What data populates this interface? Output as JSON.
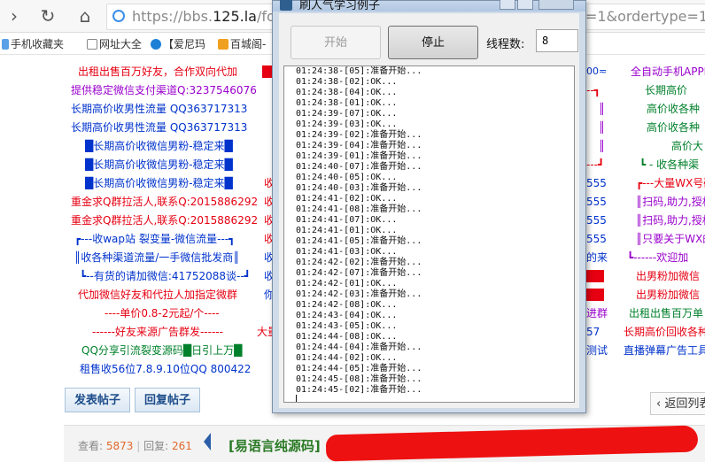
{
  "browser": {
    "url_gray_prefix": "https://bbs.",
    "url_host": "125.la",
    "url_path": "/foru",
    "url_tail": "=1&ordertype=1#",
    "bookmarks": [
      "手机收藏夹",
      "网址大全",
      "【爱尼玛",
      "百城阁-"
    ]
  },
  "ads": {
    "col1": [
      "出租出售百万好友，合作双向代加",
      "提供稳定微信支付渠道Q:3237546076",
      "长期高价收男性流量   QQ363717313",
      "长期高价收男性流量   QQ363717313",
      "█长期高价收微信男粉-稳定来█",
      "█长期高价收微信男粉-稳定来█",
      "█长期高价收微信男粉-稳定来█",
      "重金求Q群拉活人,联系Q:2015886292",
      "重金求Q群拉活人,联系Q:2015886292",
      "┏---收wap站  裂变量-微信流量---┓",
      "║收各种渠道流量/一手微信批发商║",
      "┗--有货的请加微信:41752088谈--┛",
      "代加微信好友和代拉人加指定微群",
      "----单价0.8-2元起/个----",
      "------好友来源广告群发------",
      "QQ分享引流裂变源码█日引上万█",
      "租售收56位7.8.9.10位QQ 800422"
    ],
    "col2": [
      "收",
      "收",
      "收",
      "收",
      "收",
      "收",
      "你",
      "大量"
    ],
    "col3": [
      "555",
      "555",
      "555",
      "555",
      "的来",
      "进群",
      "57",
      "测试"
    ],
    "col4": [
      "全自动手机APPE",
      "长期高价",
      "高价收各种",
      "高价收各种",
      "高价大",
      "┗ - 收各种渠",
      "┏---大量WX号码",
      "║扫码,助力,授权",
      "║扫码,助力,授权",
      "║只要关于WX的",
      "┗------欢迎加",
      "出男粉加微信",
      "出男粉加微信",
      "出租出售百万单",
      "长期高价回收各种",
      "直播弹幕广告工具"
    ]
  },
  "popup": {
    "title": "刷人气学习例子",
    "start_label": "开始",
    "stop_label": "停止",
    "threads_label": "线程数:",
    "threads_value": "8",
    "log": [
      "01:24:38-[05]:准备开始...",
      "01:24:38-[02]:OK...",
      "01:24:38-[04]:OK...",
      "01:24:38-[01]:OK...",
      "01:24:39-[07]:OK...",
      "01:24:39-[03]:OK...",
      "01:24:39-[02]:准备开始...",
      "01:24:39-[04]:准备开始...",
      "01:24:39-[01]:准备开始...",
      "01:24:40-[07]:准备开始...",
      "01:24:40-[05]:OK...",
      "01:24:40-[03]:准备开始...",
      "01:24:41-[02]:OK...",
      "01:24:41-[08]:准备开始...",
      "01:24:41-[07]:OK...",
      "01:24:41-[01]:OK...",
      "01:24:41-[05]:准备开始...",
      "01:24:41-[03]:OK...",
      "01:24:42-[02]:准备开始...",
      "01:24:42-[07]:准备开始...",
      "01:24:42-[01]:OK...",
      "01:24:42-[03]:准备开始...",
      "01:24:42-[08]:OK...",
      "01:24:43-[04]:OK...",
      "01:24:43-[05]:OK...",
      "01:24:44-[08]:OK...",
      "01:24:44-[04]:准备开始...",
      "01:24:44-[02]:OK...",
      "01:24:44-[05]:准备开始...",
      "01:24:45-[08]:准备开始...",
      "01:24:45-[02]:准备开始..."
    ]
  },
  "bottom": {
    "post_button": "发表帖子",
    "reply_button": "回复帖子",
    "back_label": "返回列表",
    "views_label": "查看:",
    "views_value": "5873",
    "replies_label": "回复:",
    "replies_value": "261",
    "thread_title": "[易语言纯源码]"
  },
  "colors": {
    "accent_blue": "#1d4d8a",
    "ad_red": "#e60012",
    "ad_blue": "#0033cc",
    "ad_purple": "#9900cc",
    "ad_green": "#00802b"
  }
}
